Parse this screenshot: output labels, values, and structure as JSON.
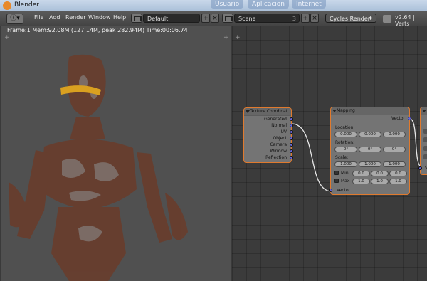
{
  "window": {
    "title": "Blender",
    "browser_tabs": [
      "Usuario",
      "Aplicacion",
      "Internet"
    ]
  },
  "menubar": {
    "items": [
      "File",
      "Add",
      "Render",
      "Window",
      "Help"
    ],
    "screen_layout": "Default",
    "scene": "Scene",
    "scene_users": "3",
    "render_engine": "Cycles Render",
    "version_info": "v2.64 | Verts"
  },
  "viewport": {
    "info": "Frame:1 Mem:92.08M (127.14M, peak 282.94M) Time:00:06.74"
  },
  "nodes": {
    "texture_coordinate": {
      "title": "Texture Coordinat",
      "outputs": [
        "Generated",
        "Normal",
        "UV",
        "Object",
        "Camera",
        "Window",
        "Reflection"
      ]
    },
    "mapping": {
      "title": "Mapping",
      "output": "Vector",
      "location_label": "Location:",
      "location": [
        "0.000",
        "0.000",
        "0.000"
      ],
      "rotation_label": "Rotation:",
      "rotation": [
        "0°",
        "0°",
        "0°"
      ],
      "scale_label": "Scale:",
      "scale": [
        "1.000",
        "1.000",
        "1.000"
      ],
      "min_label": "Min",
      "min": [
        "0.0",
        "0.0",
        "0.0"
      ],
      "max_label": "Max",
      "max": [
        "1.0",
        "1.0",
        "1.0"
      ],
      "input": "Vector"
    },
    "partial_node": {
      "input": "V"
    }
  },
  "colors": {
    "node_border": "#e07a2e",
    "socket": "#6868d8",
    "render_figure": "#6a3c2a"
  }
}
